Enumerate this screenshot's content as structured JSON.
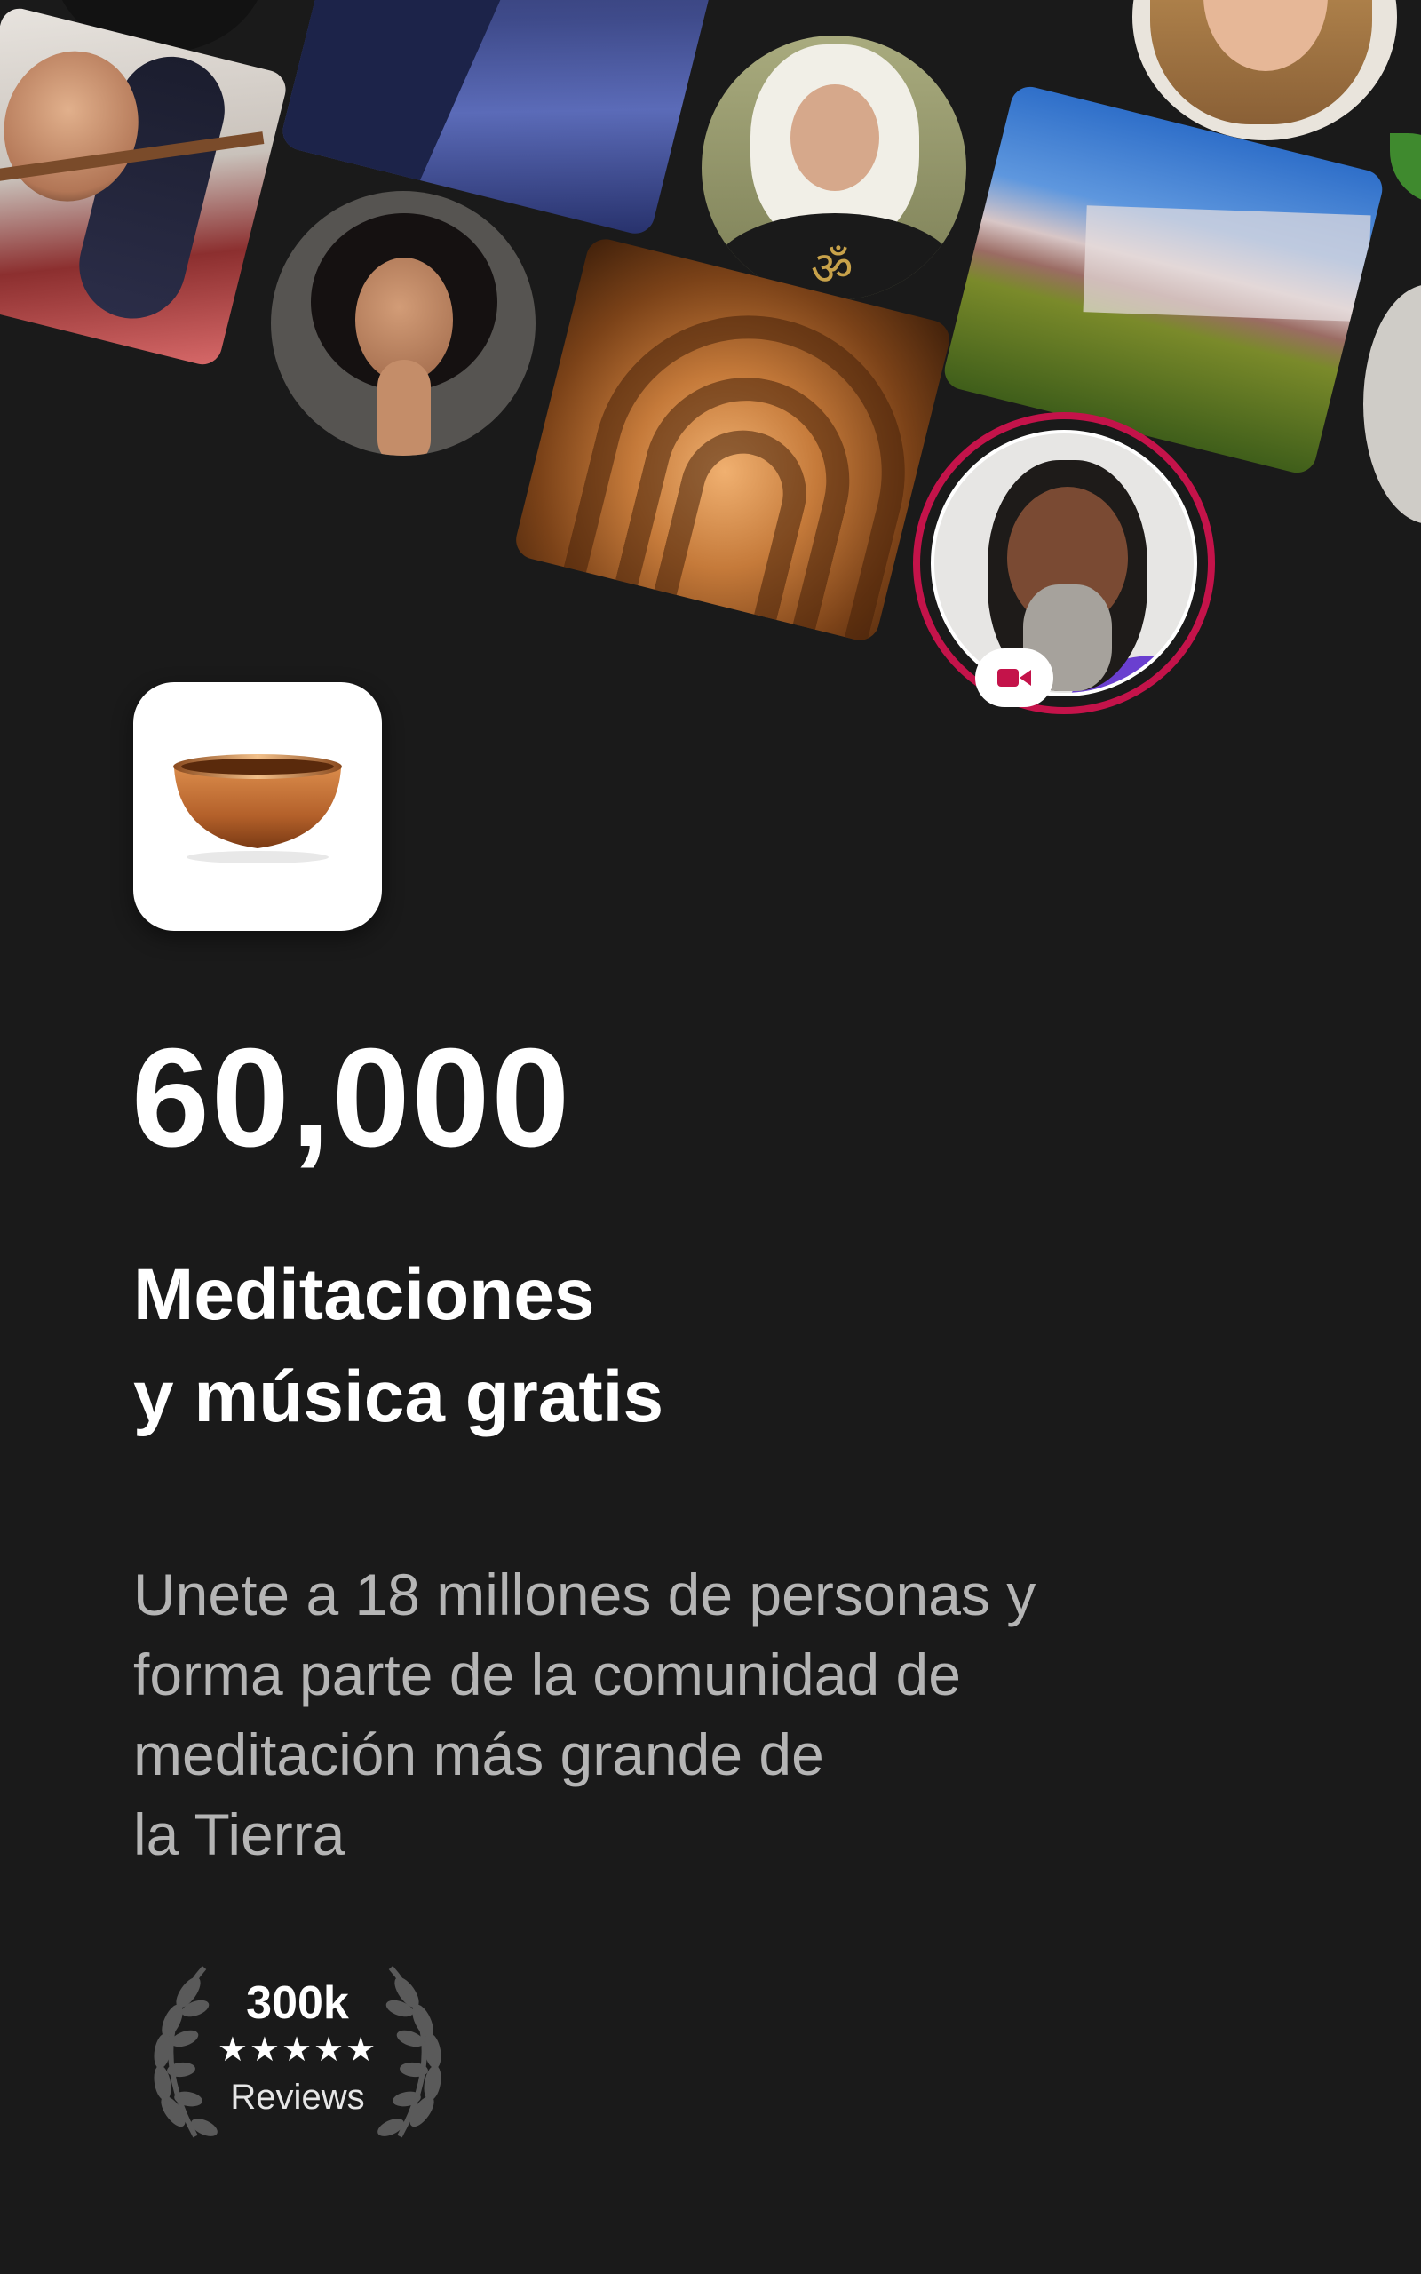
{
  "stat": {
    "number": "60,000"
  },
  "headline": {
    "line1": "Meditaciones",
    "line2": "y música gratis"
  },
  "description": {
    "line1": "Unete a 18 millones de personas y",
    "line2": "forma parte de la comunidad de",
    "line3": "meditación más grande de",
    "line4": "la Tierra"
  },
  "reviews": {
    "count": "300k",
    "stars": "★★★★★",
    "rating_stars": 5,
    "label": "Reviews"
  },
  "collage": {
    "om_symbol": "ॐ",
    "featured_badge_icon": "video-camera-icon"
  },
  "colors": {
    "background": "#1a1a1a",
    "accent": "#c4134a",
    "text_primary": "#ffffff",
    "text_secondary": "#b5b5b5"
  }
}
